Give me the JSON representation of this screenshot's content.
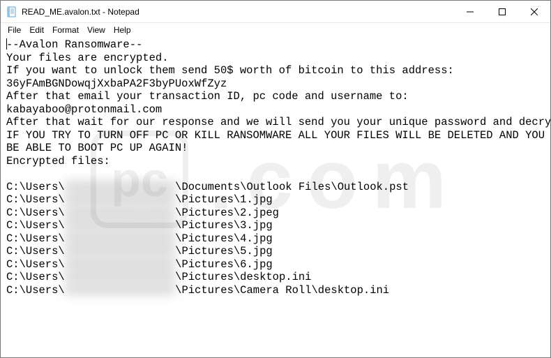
{
  "titlebar": {
    "title": "READ_ME.avalon.txt - Notepad"
  },
  "menubar": {
    "file": "File",
    "edit": "Edit",
    "format": "Format",
    "view": "View",
    "help": "Help"
  },
  "content": {
    "lines": [
      "--Avalon Ransomware--",
      "Your files are encrypted.",
      "If you want to unlock them send 50$ worth of bitcoin to this address:",
      "36yFAmBGNDowqjXxbaPA2F3byPUoxWfZyz",
      "After that email your transaction ID, pc code and username to:",
      "kabayaboo@protonmail.com",
      "After that wait for our response and we will send you your unique password and decryptor.",
      "IF YOU TRY TO TURN OFF PC OR KILL RANSOMWARE ALL YOUR FILES WILL BE DELETED AND YOU WONT",
      "BE ABLE TO BOOT PC UP AGAIN!",
      "Encrypted files:",
      ""
    ],
    "file_prefix": "C:\\Users\\",
    "blurred_placeholder": "XXXXXXXXXXXXXXXXXX",
    "file_suffixes": [
      "\\Documents\\Outlook Files\\Outlook.pst",
      "\\Pictures\\1.jpg",
      "\\Pictures\\2.jpeg",
      "\\Pictures\\3.jpg",
      "\\Pictures\\4.jpg",
      "\\Pictures\\5.jpg",
      "\\Pictures\\6.jpg",
      "\\Pictures\\desktop.ini",
      "\\Pictures\\Camera Roll\\desktop.ini"
    ]
  },
  "watermark": {
    "logo_text": "pc",
    "text": ".com"
  }
}
